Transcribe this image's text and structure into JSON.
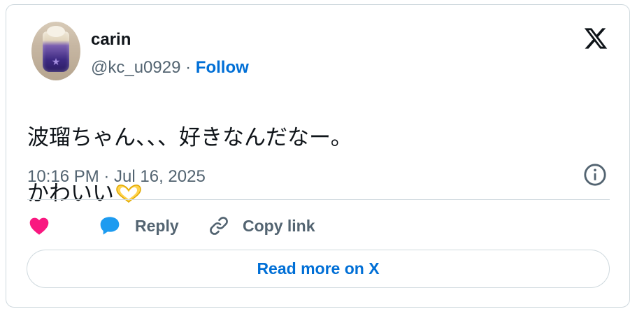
{
  "user": {
    "name": "carin",
    "handle": "@kc_u0929",
    "separator": " · ",
    "follow_label": "Follow"
  },
  "tweet": {
    "line1": "波瑠ちゃん、、、好きなんだなー。",
    "line2": "かわいい",
    "emoji_icon": "heart-hands-icon",
    "timestamp": "10:16 PM · Jul 16, 2025"
  },
  "actions": {
    "like_icon": "heart-icon",
    "reply_label": "Reply",
    "copy_link_label": "Copy link"
  },
  "footer": {
    "read_more_label": "Read more on X"
  },
  "colors": {
    "accent": "#006fd6",
    "like": "#f91880",
    "reply_icon": "#1d9bf0",
    "muted": "#536471",
    "border": "#cfd9de"
  }
}
